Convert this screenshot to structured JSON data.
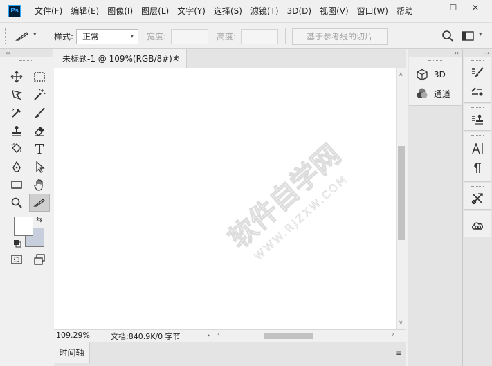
{
  "app": {
    "logo_text": "Ps"
  },
  "menu": [
    "文件(F)",
    "编辑(E)",
    "图像(I)",
    "图层(L)",
    "文字(Y)",
    "选择(S)",
    "滤镜(T)",
    "3D(D)",
    "视图(V)",
    "窗口(W)",
    "帮助"
  ],
  "window_controls": {
    "minimize": "—",
    "maximize": "☐",
    "close": "✕"
  },
  "options": {
    "style_label": "样式:",
    "style_value": "正常",
    "width_label": "宽度:",
    "height_label": "高度:",
    "slice_button": "基于参考线的切片"
  },
  "document": {
    "tab_title": "未标题-1 @ 109%(RGB/8#) *",
    "tab_close": "✕",
    "watermark": "软件自学网",
    "watermark_sub": "WWW.RJZXW.COM"
  },
  "status": {
    "zoom": "109.29%",
    "doc_info": "文档:840.9K/0 字节",
    "more_arrow": "›"
  },
  "timeline": {
    "tab": "时间轴"
  },
  "panels": {
    "collapse_glyph": "‹‹",
    "items": [
      {
        "label": "3D",
        "icon": "cube-icon"
      },
      {
        "label": "通道",
        "icon": "channels-icon"
      }
    ]
  }
}
